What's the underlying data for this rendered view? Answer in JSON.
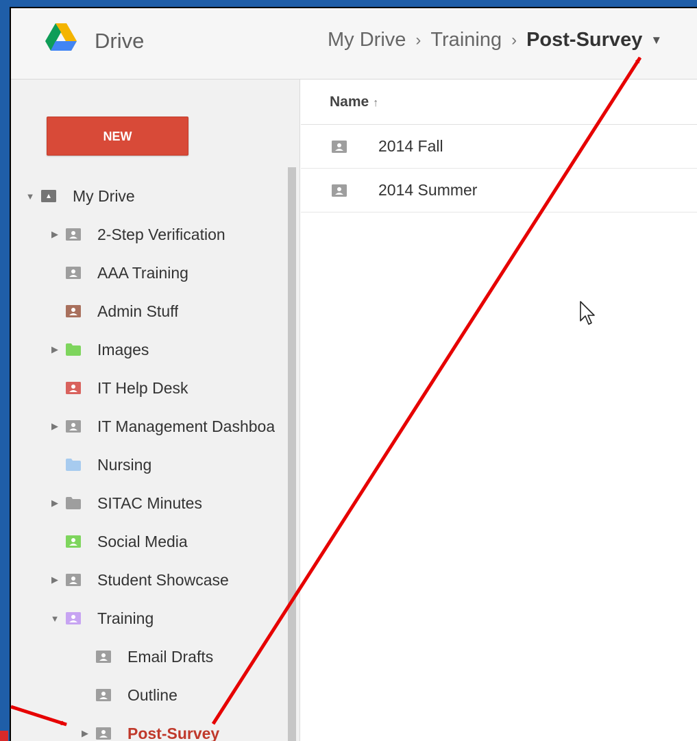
{
  "app": {
    "title": "Drive"
  },
  "breadcrumb": {
    "items": [
      "My Drive",
      "Training"
    ],
    "current": "Post-Survey"
  },
  "sidebar": {
    "new_button": "NEW",
    "tree": [
      {
        "label": "My Drive",
        "depth": 0,
        "arrow": "expanded",
        "icon": "drive-folder-icon",
        "color": "#757575"
      },
      {
        "label": "2-Step Verification",
        "depth": 1,
        "arrow": "collapsed",
        "icon": "shared-folder-icon",
        "color": "#9e9e9e"
      },
      {
        "label": "AAA Training",
        "depth": 1,
        "arrow": "none",
        "icon": "shared-folder-icon",
        "color": "#9e9e9e"
      },
      {
        "label": "Admin Stuff",
        "depth": 1,
        "arrow": "none",
        "icon": "shared-folder-icon",
        "color": "#a9705d"
      },
      {
        "label": "Images",
        "depth": 1,
        "arrow": "collapsed",
        "icon": "folder-icon",
        "color": "#7ed55d"
      },
      {
        "label": "IT Help Desk",
        "depth": 1,
        "arrow": "none",
        "icon": "shared-folder-icon",
        "color": "#d9625d"
      },
      {
        "label": "IT Management Dashboa",
        "depth": 1,
        "arrow": "collapsed",
        "icon": "shared-folder-icon",
        "color": "#9e9e9e"
      },
      {
        "label": "Nursing",
        "depth": 1,
        "arrow": "none",
        "icon": "folder-icon",
        "color": "#a7cbef"
      },
      {
        "label": "SITAC Minutes",
        "depth": 1,
        "arrow": "collapsed",
        "icon": "folder-icon",
        "color": "#9e9e9e"
      },
      {
        "label": "Social Media",
        "depth": 1,
        "arrow": "none",
        "icon": "shared-folder-icon",
        "color": "#7ed55d"
      },
      {
        "label": "Student Showcase",
        "depth": 1,
        "arrow": "collapsed",
        "icon": "shared-folder-icon",
        "color": "#9e9e9e"
      },
      {
        "label": "Training",
        "depth": 1,
        "arrow": "expanded",
        "icon": "shared-folder-icon",
        "color": "#c7a4f2"
      },
      {
        "label": "Email Drafts",
        "depth": 2,
        "arrow": "none",
        "icon": "shared-folder-icon",
        "color": "#9e9e9e"
      },
      {
        "label": "Outline",
        "depth": 2,
        "arrow": "none",
        "icon": "shared-folder-icon",
        "color": "#9e9e9e"
      },
      {
        "label": "Post-Survey",
        "depth": 2,
        "arrow": "collapsed",
        "icon": "shared-folder-icon",
        "color": "#9e9e9e",
        "active": true
      }
    ]
  },
  "file_list": {
    "header": {
      "name": "Name",
      "sort_icon": "arrow-up-icon",
      "sort_glyph": "↑"
    },
    "rows": [
      {
        "name": "2014 Fall",
        "icon": "shared-folder-icon",
        "color": "#9e9e9e"
      },
      {
        "name": "2014 Summer",
        "icon": "shared-folder-icon",
        "color": "#9e9e9e"
      }
    ]
  },
  "colors": {
    "accent": "#d84a38",
    "annotation": "#e60000",
    "background": "#1f5ea8",
    "logo_green": "#0f9d58",
    "logo_yellow": "#f4b400",
    "logo_blue": "#4285f4"
  }
}
